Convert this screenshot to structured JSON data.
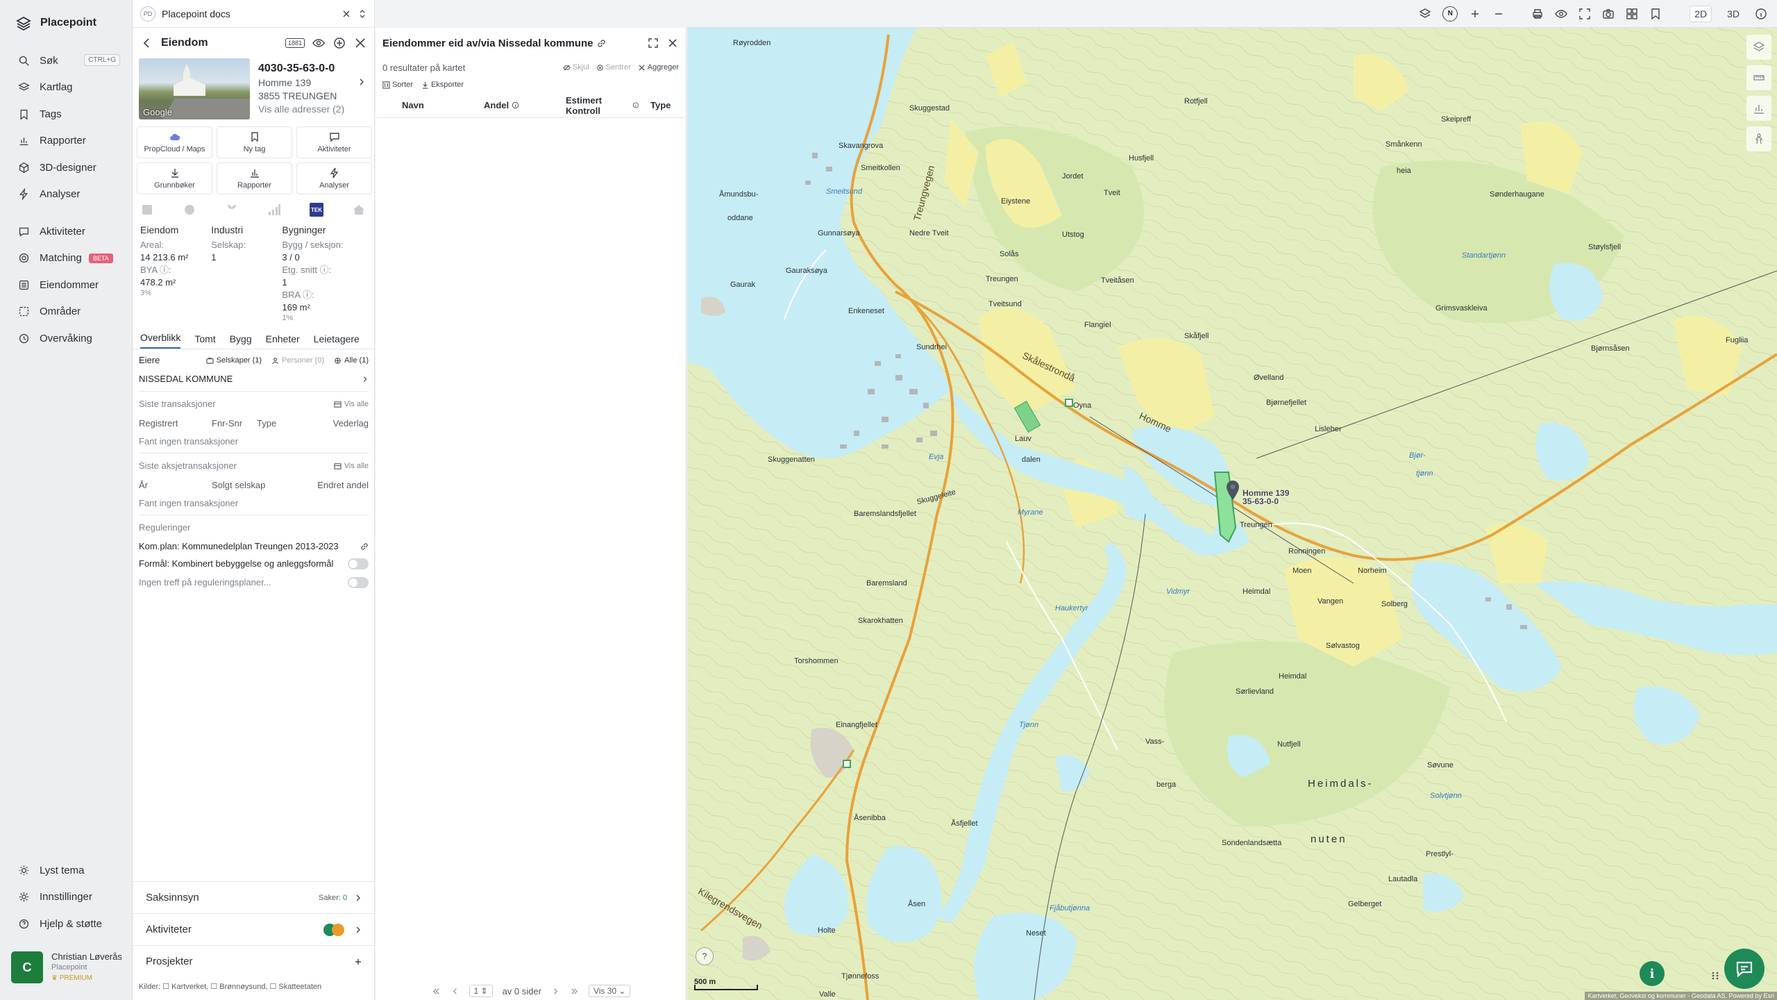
{
  "nav": {
    "brand": "Placepoint",
    "items": [
      {
        "label": "Søk",
        "icon": "search-icon",
        "kbd": "CTRL+G"
      },
      {
        "label": "Kartlag",
        "icon": "layers-icon"
      },
      {
        "label": "Tags",
        "icon": "bookmark-icon"
      },
      {
        "label": "Rapporter",
        "icon": "bar-chart-icon"
      },
      {
        "label": "3D-designer",
        "icon": "cube-icon"
      },
      {
        "label": "Analyser",
        "icon": "bolt-icon"
      }
    ],
    "items2": [
      {
        "label": "Aktiviteter",
        "icon": "chat-icon"
      },
      {
        "label": "Matching",
        "icon": "target-icon",
        "badge": "BETA"
      },
      {
        "label": "Eiendommer",
        "icon": "list-icon"
      },
      {
        "label": "Områder",
        "icon": "area-icon"
      },
      {
        "label": "Overvåking",
        "icon": "monitor-icon"
      }
    ],
    "items3": [
      {
        "label": "Lyst tema",
        "icon": "sun-icon"
      },
      {
        "label": "Innstillinger",
        "icon": "gear-icon"
      },
      {
        "label": "Hjelp & støtte",
        "icon": "help-icon"
      }
    ],
    "user": {
      "initial": "C",
      "name": "Christian Løverås",
      "org": "Placepoint",
      "plan": "PREMIUM"
    }
  },
  "doc": {
    "badge": "PD",
    "title": "Placepoint docs"
  },
  "property": {
    "header": "Eiendom",
    "id": "4030-35-63-0-0",
    "address": "Homme 139",
    "postal": "3855 TREUNGEN",
    "all_addresses": "Vis alle adresser (2)",
    "photo_label": "Google",
    "buttons": [
      {
        "label": "PropCloud / Maps",
        "icon": "cloud-icon"
      },
      {
        "label": "Ny tag",
        "icon": "bookmark-icon"
      },
      {
        "label": "Aktiviteter",
        "icon": "chat-icon"
      },
      {
        "label": "Grunnbøker",
        "icon": "download-icon"
      },
      {
        "label": "Rapporter",
        "icon": "bar-chart-icon"
      },
      {
        "label": "Analyser",
        "icon": "bolt-icon"
      }
    ],
    "tek": "TEK",
    "stats": {
      "eiendom": {
        "title": "Eiendom",
        "areal_label": "Areal:",
        "areal": "14 213.6 m²",
        "bya_label": "BYA ⓘ:",
        "bya": "478.2 m²",
        "bya_pct": "3%"
      },
      "industri": {
        "title": "Industri",
        "selskap_label": "Selskap:",
        "selskap": "1"
      },
      "bygninger": {
        "title": "Bygninger",
        "bygg_label": "Bygg / seksjon:",
        "bygg": "3 / 0",
        "etg_label": "Etg. snitt ⓘ:",
        "etg": "1",
        "bra_label": "BRA ⓘ:",
        "bra": "169 m²",
        "bra_pct": "1%"
      }
    },
    "tabs": [
      "Overblikk",
      "Tomt",
      "Bygg",
      "Enheter",
      "Leietagere"
    ],
    "owners": {
      "label": "Eiere",
      "selskaper": "Selskaper (1)",
      "personer": "Personer (0)",
      "alle": "Alle (1)",
      "name": "NISSEDAL KOMMUNE"
    },
    "transactions": {
      "title": "Siste transaksjoner",
      "vis_alle": "Vis alle",
      "cols": [
        "Registrert",
        "Fnr-Snr",
        "Type",
        "Vederlag"
      ],
      "empty": "Fant ingen transaksjoner"
    },
    "share_tx": {
      "title": "Siste aksjetransaksjoner",
      "vis_alle": "Vis alle",
      "cols": [
        "År",
        "Solgt selskap",
        "Endret andel"
      ],
      "empty": "Fant ingen transaksjoner"
    },
    "regulations": {
      "title": "Reguleringer",
      "plan": "Kom.plan: Kommunedelplan Treungen 2013-2023",
      "formal": "Formål: Kombinert bebyggelse og anleggsformål",
      "none": "Ingen treff på reguleringsplaner..."
    },
    "bottom": {
      "saksinnsyn": "Saksinnsyn",
      "saker_label": "Saker:",
      "saker": "0",
      "aktiviteter": "Aktiviteter",
      "prosjekter": "Prosjekter"
    },
    "kilder": "Kilder: ☐ Kartverket, ☐ Brønnøysund, ☐ Skatteetaten"
  },
  "owned": {
    "title": "Eiendommer eid av/via Nissedal kommune",
    "results": "0 resultater på kartet",
    "skjul": "Skjul",
    "sentrer": "Sentrer",
    "aggreger": "Aggreger",
    "sorter": "Sorter",
    "eksporter": "Eksporter",
    "columns": [
      "Navn",
      "Andel",
      "Estimert Kontroll",
      "Type"
    ],
    "pager": {
      "page": "1",
      "of": "av 0 sider",
      "per": "Vis 30"
    }
  },
  "topbar": {
    "north": "N",
    "dim2": "2D",
    "dim3": "3D"
  },
  "map": {
    "scale": "500 m",
    "pin_label_1": "Homme 139",
    "pin_label_2": "35-63-0-0",
    "attribution": "Kartverket, Geovekst og kommuner - Geodata AS, Powered by Esri",
    "labels": {
      "l1": "Røyrodden",
      "l2": "Skuggestad",
      "l3": "Skavangrova",
      "l4": "Smeitkollen",
      "l5": "Treungvegen",
      "l6": "Åmundsbu-",
      "l7": "oddane",
      "l8": "Smeitsund",
      "l9": "Nedre Tveit",
      "l10": "Gunnarsøya",
      "l11": "Gauraksøya",
      "l12": "Gaurak",
      "l13": "Enkeneset",
      "l14": "Treungen",
      "l15": "Tveitsund",
      "l16": "Sundrhei",
      "l17": "Skålestrondå",
      "l18": "Homme",
      "l19": "Lauv",
      "l20": "dalen",
      "l21": "Oyna",
      "l22": "Skuggenatten",
      "l23": "Evja",
      "l24": "Skuggeleite",
      "l25": "Baremslandsfjellet",
      "l26": "Myrane",
      "l27": "Baremsland",
      "l28": "Skarokhatten",
      "l29": "Torshommen",
      "l30": "Einangfjellet",
      "l31": "Åsenibba",
      "l32": "Åsfjellet",
      "l33": "Åsen",
      "l34": "Holte",
      "l35": "Kilegrendsvegen",
      "l36": "Tjønnefoss",
      "l37": "Valle",
      "l38": "Eiystene",
      "l39": "Solås",
      "l40": "Jordet",
      "l41": "Utstog",
      "l42": "Tveit",
      "l43": "Husfjell",
      "l44": "Rotfjell",
      "l45": "Tveitåsen",
      "l46": "Flangiel",
      "l47": "Skåfjell",
      "l48": "Øvelland",
      "l49": "Bjørnefjellet",
      "l50": "Lisleheı",
      "l51": "Ronningen",
      "l52": "Heimdal",
      "l53": "Moen",
      "l54": "Norheim",
      "l55": "Vangen",
      "l56": "Solberg",
      "l57": "Sølvastog",
      "l58": "Heimdal",
      "l59": "Sørlievland",
      "l60": "Nutfjell",
      "l61": "Vass-",
      "l62": "berga",
      "l63": "Heimdals-",
      "l64": "nuten",
      "l65": "Sondenlandsætta",
      "l66": "Søvune",
      "l67": "Prestlyl-",
      "l68": "Gelberget",
      "l69": "Lautadla",
      "l70": "Neset",
      "l71": "Smånkenn",
      "l72": "Skeipreff",
      "l73": "Sønderhaugane",
      "l74": "Støylsfjell",
      "l75": "Grimsvaskleiva",
      "l76": "Fugliia",
      "l77": "Bjørnsåsen",
      "l78": "Treungen",
      "l79": "heia",
      "l80": "Bjør-",
      "l81": "tjønn",
      "l82": "Standartjønn",
      "l83": "Tjønn",
      "l84": "Solvtjønn",
      "l85": "Fjåbutjønna",
      "l86": "Vidmyr",
      "l87": "Haukertyr"
    }
  }
}
